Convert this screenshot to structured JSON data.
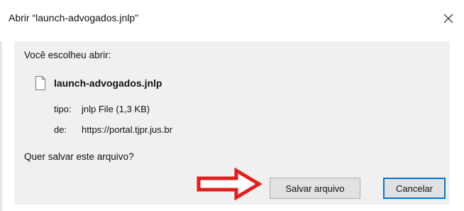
{
  "window": {
    "title": "Abrir “launch-advogados.jnlp”",
    "close_icon": "close-icon"
  },
  "body": {
    "intro": "Você escolheu abrir:",
    "file_icon": "document-icon",
    "file_name": "launch-advogados.jnlp",
    "type_label": "tipo:",
    "type_value": "jnlp File (1,3 KB)",
    "from_label": "de:",
    "from_value": "https://portal.tjpr.jus.br",
    "question": "Quer salvar este arquivo?"
  },
  "annotation": {
    "arrow_icon": "arrow-right-icon",
    "arrow_color": "#e0201c"
  },
  "buttons": {
    "save_label": "Salvar arquivo",
    "cancel_label": "Cancelar"
  },
  "colors": {
    "dialog_bg": "#f0f0f0",
    "focus_border": "#0078d7"
  }
}
